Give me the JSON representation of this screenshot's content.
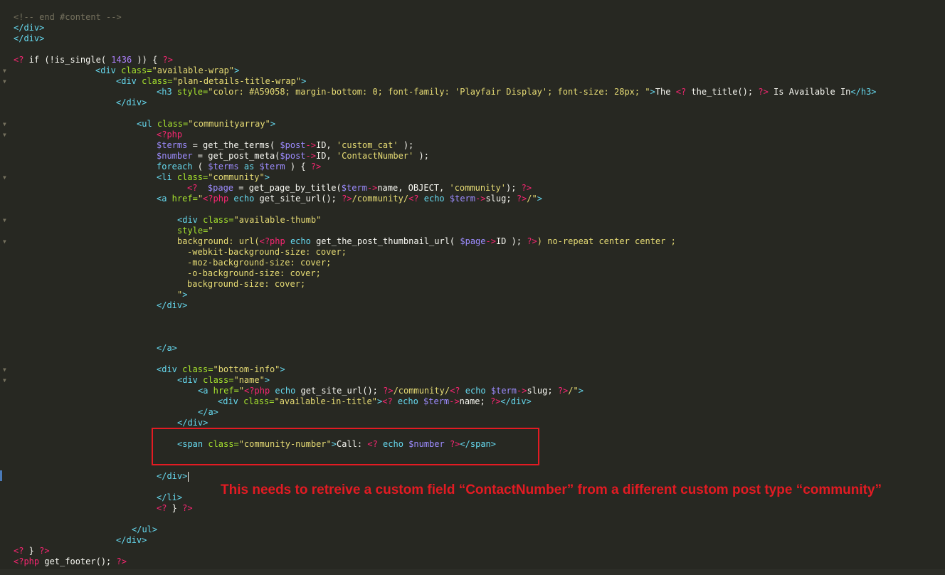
{
  "annotation": {
    "text": "This needs to retreive a custom field “ContactNumber” from a different custom post type “community”"
  },
  "colors": {
    "background": "#272822",
    "annotation": "#e31b23",
    "highlight_border": "#e31b23"
  },
  "code": {
    "l01a": "<!-- end #content -->",
    "l02a": "</div>",
    "l03a": "</div>",
    "l05a": "<?",
    "l05b": " if (!is_single( ",
    "l05c": "1436",
    "l05d": " )) { ",
    "l05e": "?>",
    "l06a": "<div",
    "l06b": " class=",
    "l06c": "\"available-wrap\"",
    "l06d": ">",
    "l07a": "<div",
    "l07b": " class=",
    "l07c": "\"plan-details-title-wrap\"",
    "l07d": ">",
    "l08a": "<h3",
    "l08b": " style=",
    "l08c": "\"color: #A59058; margin-bottom: 0; font-family: 'Playfair Display'; font-size: 28px; \"",
    "l08d": ">",
    "l08e": "The ",
    "l08f": "<?",
    "l08g": " the_title(); ",
    "l08h": "?>",
    "l08i": " Is Available In",
    "l08j": "</h3>",
    "l09a": "</div>",
    "l11a": "<ul",
    "l11b": " class=",
    "l11c": "\"communityarray\"",
    "l11d": ">",
    "l12a": "<?php",
    "l13a": "$terms",
    "l13b": " = get_the_terms( ",
    "l13c": "$post",
    "l13d": "->",
    "l13e": "ID, ",
    "l13f": "'custom_cat'",
    "l13g": " );",
    "l14a": "$number",
    "l14b": " = get_post_meta(",
    "l14c": "$post",
    "l14d": "->",
    "l14e": "ID, ",
    "l14f": "'ContactNumber'",
    "l14g": " );",
    "l15a": "foreach",
    "l15b": " ( ",
    "l15c": "$terms",
    "l15d": " as ",
    "l15e": "$term",
    "l15f": " ) { ",
    "l15g": "?>",
    "l16a": "<li",
    "l16b": " class=",
    "l16c": "\"community\"",
    "l16d": ">",
    "l17a": "<?",
    "l17b": "  ",
    "l17c": "$page",
    "l17d": " = get_page_by_title(",
    "l17e": "$term",
    "l17f": "->",
    "l17g": "name, OBJECT, ",
    "l17h": "'community'",
    "l17i": "); ",
    "l17j": "?>",
    "l18a": "<a",
    "l18b": " href=",
    "l18c": "\"",
    "l18d": "<?php",
    "l18e": " echo ",
    "l18f": "get_site_url(); ",
    "l18g": "?>",
    "l18h": "/community/",
    "l18i": "<?",
    "l18j": " echo ",
    "l18k": "$term",
    "l18l": "->",
    "l18m": "slug; ",
    "l18n": "?>",
    "l18o": "/\"",
    "l18p": ">",
    "l20a": "<div",
    "l20b": " class=",
    "l20c": "\"available-thumb\"",
    "l21a": "style=",
    "l21b": "\"",
    "l22a": "background: url(",
    "l22b": "<?php",
    "l22c": " echo ",
    "l22d": "get_the_post_thumbnail_url( ",
    "l22e": "$page",
    "l22f": "->",
    "l22g": "ID ); ",
    "l22h": "?>",
    "l22i": ") no-repeat center center ;",
    "l23a": "-webkit-background-size: cover;",
    "l24a": "-moz-background-size: cover;",
    "l25a": "-o-background-size: cover;",
    "l26a": "background-size: cover;",
    "l27a": "\"",
    "l27b": ">",
    "l28a": "</div>",
    "l32a": "</a>",
    "l34a": "<div",
    "l34b": " class=",
    "l34c": "\"bottom-info\"",
    "l34d": ">",
    "l35a": "<div",
    "l35b": " class=",
    "l35c": "\"name\"",
    "l35d": ">",
    "l36a": "<a",
    "l36b": " href=",
    "l36c": "\"",
    "l36d": "<?php",
    "l36e": " echo ",
    "l36f": "get_site_url(); ",
    "l36g": "?>",
    "l36h": "/community/",
    "l36i": "<?",
    "l36j": " echo ",
    "l36k": "$term",
    "l36l": "->",
    "l36m": "slug; ",
    "l36n": "?>",
    "l36o": "/\"",
    "l36p": ">",
    "l37a": "<div",
    "l37b": " class=",
    "l37c": "\"available-in-title\"",
    "l37d": ">",
    "l37e": "<?",
    "l37f": " echo ",
    "l37g": "$term",
    "l37h": "->",
    "l37i": "name; ",
    "l37j": "?>",
    "l37k": "</div>",
    "l38a": "</a>",
    "l39a": "</div>",
    "l41a": "<span",
    "l41b": " class=",
    "l41c": "\"community-number\"",
    "l41d": ">",
    "l41e": "Call: ",
    "l41f": "<?",
    "l41g": " echo ",
    "l41h": "$number",
    "l41i": " ",
    "l41j": "?>",
    "l41k": "</span>",
    "l44a": "</div>",
    "l46a": "</li>",
    "l47a": "<?",
    "l47b": " } ",
    "l47c": "?>",
    "l49a": "</ul>",
    "l50a": "</div>",
    "l51a": "<?",
    "l51b": " } ",
    "l51c": "?>",
    "l52a": "<?php",
    "l52b": " get_footer(); ",
    "l52c": "?>"
  }
}
